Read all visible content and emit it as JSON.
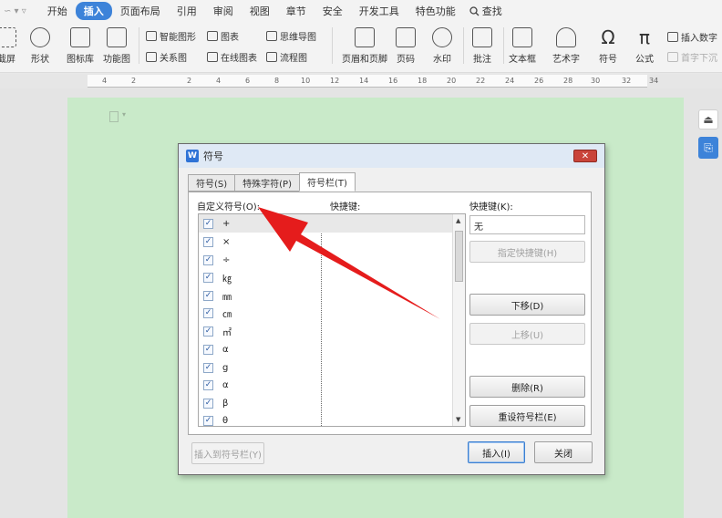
{
  "menubar": {
    "quick_access": "∽ ▾ ▿",
    "items": [
      "开始",
      "插入",
      "页面布局",
      "引用",
      "审阅",
      "视图",
      "章节",
      "安全",
      "开发工具",
      "特色功能"
    ],
    "active_index": 1,
    "search_label": "查找"
  },
  "ribbon": {
    "screenshot": "截屏",
    "shapes": "形状",
    "icon_lib": "图标库",
    "func_chart": "功能图",
    "smart_shape": "智能图形",
    "chart": "图表",
    "mindmap": "思维导图",
    "relation": "关系图",
    "online_chart": "在线图表",
    "flowchart": "流程图",
    "header_footer": "页眉和页脚",
    "page_num": "页码",
    "watermark": "水印",
    "comment": "批注",
    "textbox": "文本框",
    "wordart": "艺术字",
    "symbol": "符号",
    "formula": "公式",
    "insert_num": "插入数字",
    "dropcap": "首字下沉"
  },
  "ruler": {
    "ticks": [
      "4",
      "2",
      "2",
      "4",
      "6",
      "8",
      "10",
      "12",
      "14",
      "16",
      "18",
      "20",
      "22",
      "24",
      "26",
      "28",
      "30",
      "32",
      "34"
    ]
  },
  "dialog": {
    "title": "符号",
    "close": "✕",
    "tabs": [
      "符号(S)",
      "特殊字符(P)",
      "符号栏(T)"
    ],
    "custom_symbols_label": "自定义符号(O):",
    "shortcut_col_label": "快捷键:",
    "shortcut_field_label": "快捷键(K):",
    "shortcut_value": "无",
    "symbols": [
      "+",
      "×",
      "÷",
      "㎏",
      "㎜",
      "㎝",
      "㎡",
      "α",
      "g",
      "α",
      "β",
      "θ"
    ],
    "assign_shortcut": "指定快捷键(H)",
    "move_down": "下移(D)",
    "move_up": "上移(U)",
    "delete": "删除(R)",
    "reset_bar": "重设符号栏(E)",
    "insert_to_bar": "插入到符号栏(Y)",
    "insert": "插入(I)",
    "close_btn": "关闭"
  },
  "colors": {
    "accent": "#3d83d9",
    "page": "#c9eac9",
    "arrow": "#e51c1c"
  }
}
